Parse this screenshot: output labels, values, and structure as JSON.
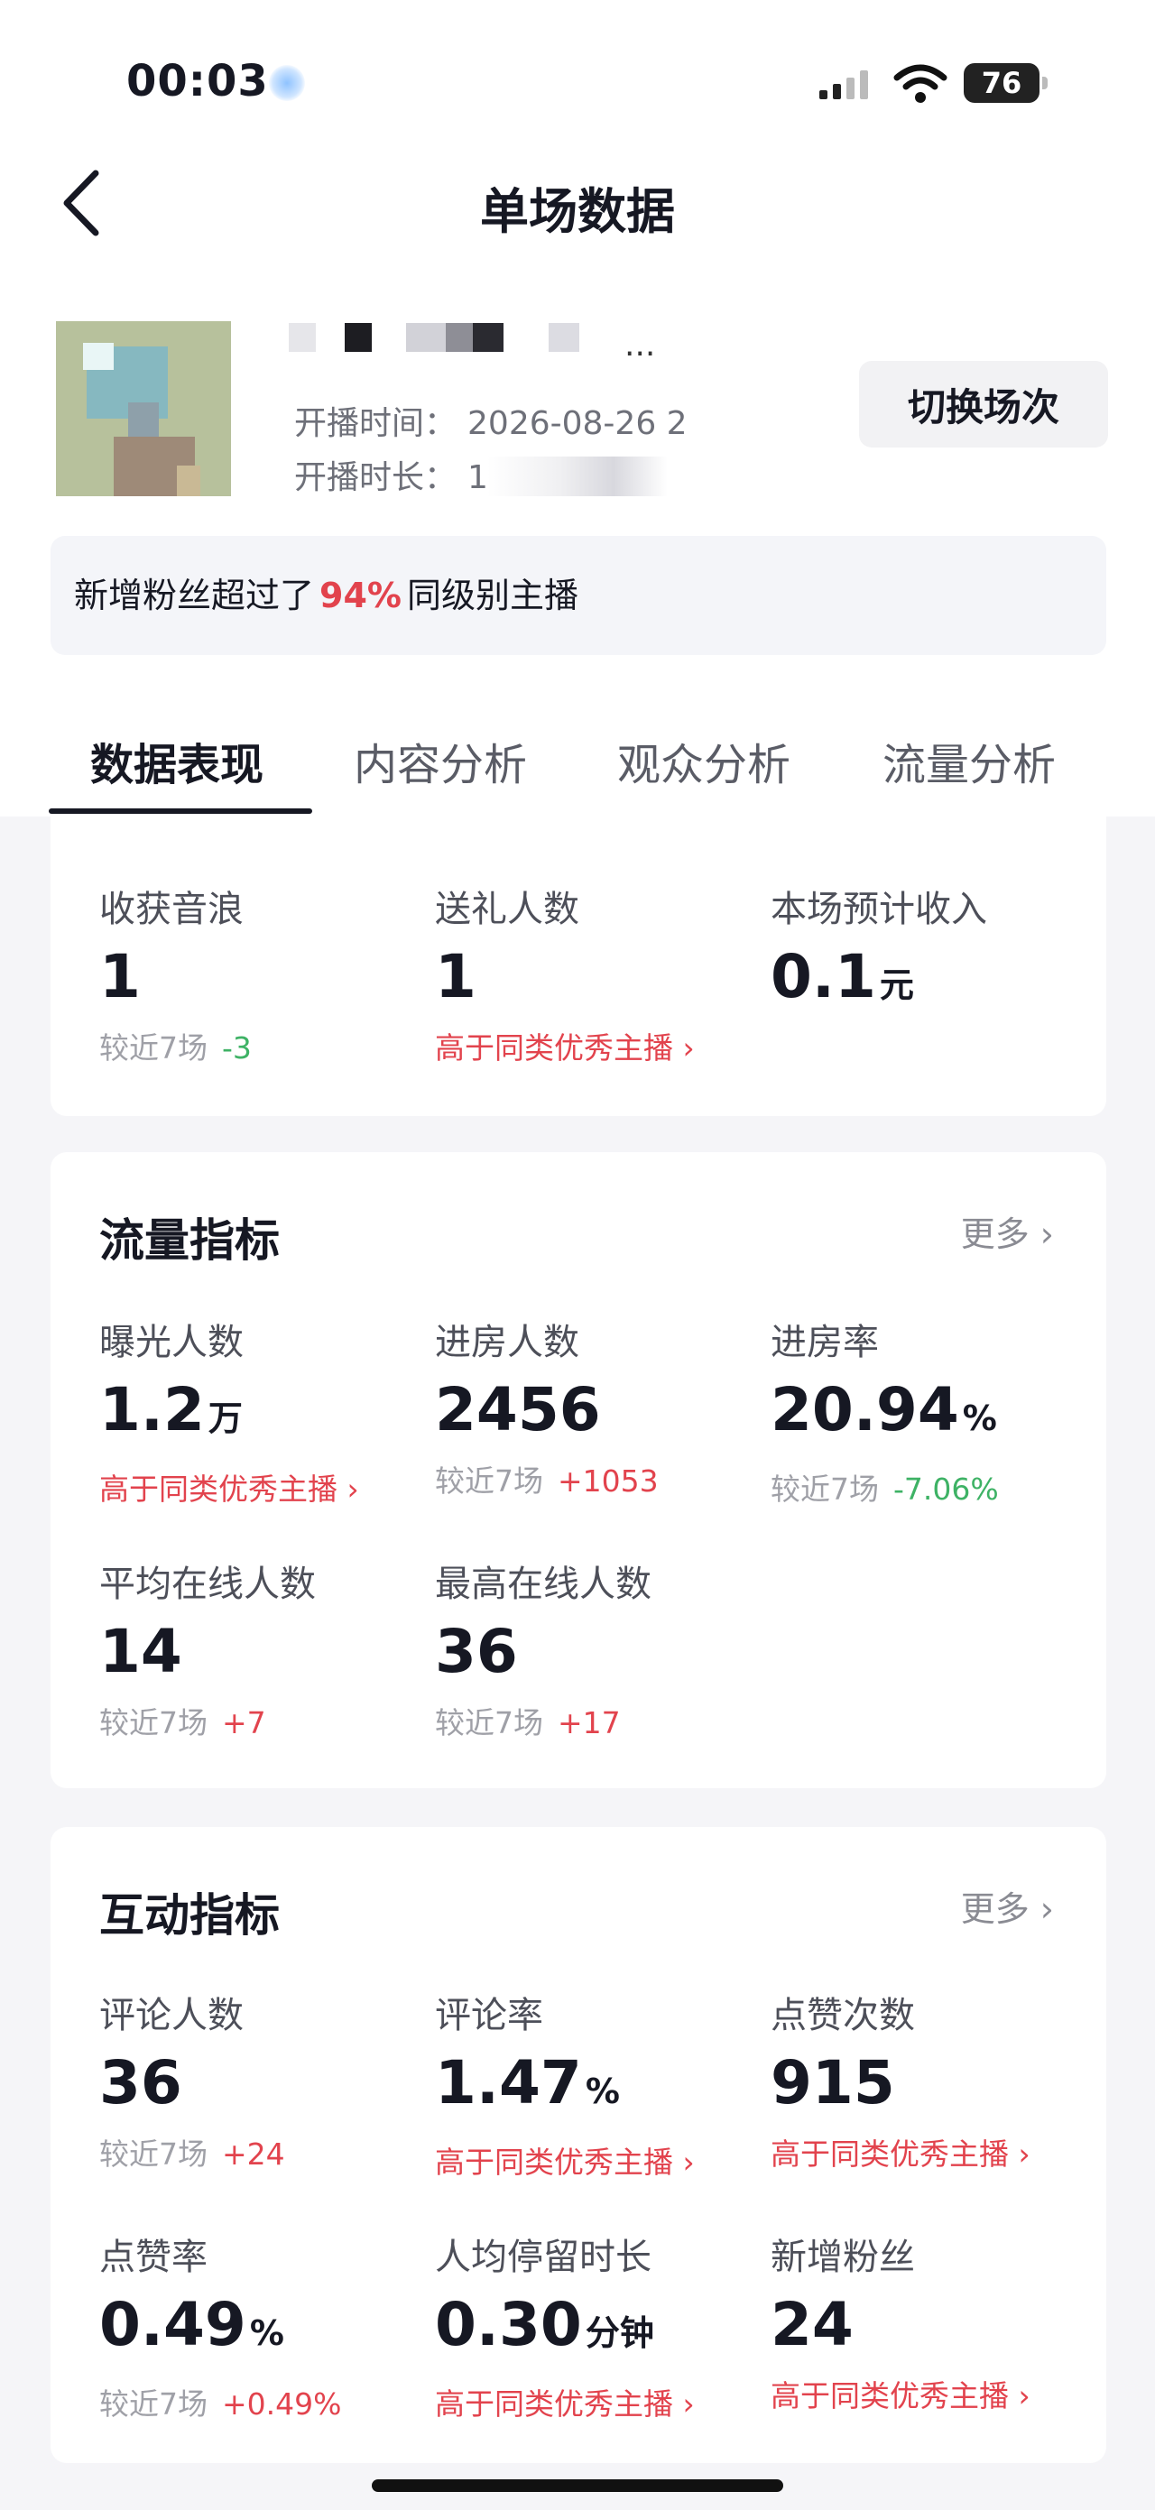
{
  "status_bar": {
    "time": "00:03",
    "battery": "76"
  },
  "header": {
    "title": "单场数据"
  },
  "live_info": {
    "anchor_dots": "...",
    "start_time_label": "开播时间：",
    "start_time_value": "2026-08-26 2",
    "duration_label": "开播时长：",
    "duration_value": "1",
    "switch_button": "切换场次"
  },
  "notice": {
    "prefix": "新增粉丝超过了",
    "percent": "94%",
    "suffix": "同级别主播"
  },
  "tabs": [
    {
      "label": "数据表现",
      "active": true
    },
    {
      "label": "内容分析",
      "active": false
    },
    {
      "label": "观众分析",
      "active": false
    },
    {
      "label": "流量分析",
      "active": false
    }
  ],
  "revenue": {
    "metrics": [
      {
        "label": "收获音浪",
        "value": "1",
        "unit": "",
        "compare_label": "较近7场",
        "delta": "-3",
        "trend": "down"
      },
      {
        "label": "送礼人数",
        "value": "1",
        "unit": "",
        "better_text": "高于同类优秀主播"
      },
      {
        "label": "本场预计收入",
        "value": "0.1",
        "unit": "元"
      }
    ]
  },
  "traffic": {
    "title": "流量指标",
    "more": "更多",
    "metrics": [
      {
        "label": "曝光人数",
        "value": "1.2",
        "unit": "万",
        "better_text": "高于同类优秀主播"
      },
      {
        "label": "进房人数",
        "value": "2456",
        "unit": "",
        "compare_label": "较近7场",
        "delta": "+1053",
        "trend": "up"
      },
      {
        "label": "进房率",
        "value": "20.94",
        "unit": "%",
        "compare_label": "较近7场",
        "delta": "-7.06%",
        "trend": "down"
      },
      {
        "label": "平均在线人数",
        "value": "14",
        "unit": "",
        "compare_label": "较近7场",
        "delta": "+7",
        "trend": "up"
      },
      {
        "label": "最高在线人数",
        "value": "36",
        "unit": "",
        "compare_label": "较近7场",
        "delta": "+17",
        "trend": "up"
      }
    ]
  },
  "interaction": {
    "title": "互动指标",
    "more": "更多",
    "metrics": [
      {
        "label": "评论人数",
        "value": "36",
        "unit": "",
        "compare_label": "较近7场",
        "delta": "+24",
        "trend": "up"
      },
      {
        "label": "评论率",
        "value": "1.47",
        "unit": "%",
        "better_text": "高于同类优秀主播"
      },
      {
        "label": "点赞次数",
        "value": "915",
        "unit": "",
        "better_text": "高于同类优秀主播"
      },
      {
        "label": "点赞率",
        "value": "0.49",
        "unit": "%",
        "compare_label": "较近7场",
        "delta": "+0.49%",
        "trend": "up"
      },
      {
        "label": "人均停留时长",
        "value": "0.30",
        "unit": "分钟",
        "better_text": "高于同类优秀主播"
      },
      {
        "label": "新增粉丝",
        "value": "24",
        "unit": "",
        "better_text": "高于同类优秀主播"
      }
    ]
  },
  "colors": {
    "accent_red": "#e2434d",
    "accent_green": "#3eb265",
    "text_primary": "#161823",
    "text_secondary": "#9fa0a7"
  }
}
